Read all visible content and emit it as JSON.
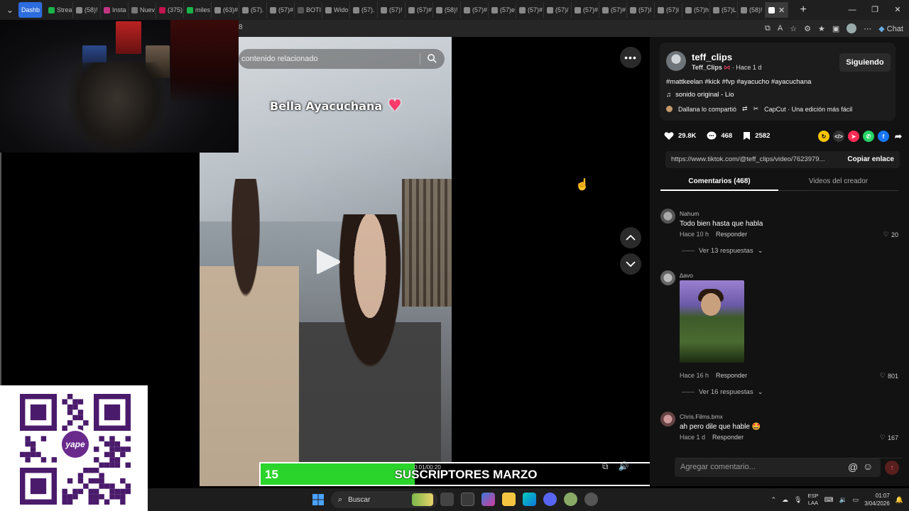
{
  "browser": {
    "tabs": [
      {
        "label": "Dashb",
        "color": "#2d6cdf"
      },
      {
        "label": "Strea",
        "color": "#1ab34a"
      },
      {
        "label": "(58)!",
        "color": "#888"
      },
      {
        "label": "Insta",
        "color": "#c13584"
      },
      {
        "label": "Nuev",
        "color": "#777"
      },
      {
        "label": "(375)",
        "color": "#c0144f"
      },
      {
        "label": "miles",
        "color": "#1ab34a"
      },
      {
        "label": "(63)#",
        "color": "#888"
      },
      {
        "label": "(57).",
        "color": "#888"
      },
      {
        "label": "(57)#",
        "color": "#888"
      },
      {
        "label": "BOTI",
        "color": "#555"
      },
      {
        "label": "Wido",
        "color": "#888"
      },
      {
        "label": "(57).",
        "color": "#888"
      },
      {
        "label": "(57)!",
        "color": "#888"
      },
      {
        "label": "(57)#",
        "color": "#888"
      },
      {
        "label": "(58)!",
        "color": "#888"
      },
      {
        "label": "(57)#",
        "color": "#888"
      },
      {
        "label": "(57)e",
        "color": "#888"
      },
      {
        "label": "(57)#",
        "color": "#888"
      },
      {
        "label": "(57)/",
        "color": "#888"
      },
      {
        "label": "(57)#",
        "color": "#888"
      },
      {
        "label": "(57)#",
        "color": "#888"
      },
      {
        "label": "(57)I",
        "color": "#888"
      },
      {
        "label": "(57)l",
        "color": "#888"
      },
      {
        "label": "(57)h",
        "color": "#888"
      },
      {
        "label": "(57)L",
        "color": "#888"
      },
      {
        "label": "(58)!",
        "color": "#888"
      }
    ],
    "url_fragment": "8",
    "chat_label": "Chat"
  },
  "video": {
    "search_placeholder": "contenido relacionado",
    "caption": "Bella Ayacuchana",
    "time": "0:01/00:20"
  },
  "subscriber_goal": {
    "current": "15",
    "title": "SUSCRIPTORES MARZO",
    "goal": "40",
    "progress": 0.375,
    "fill_color": "#2bd42b"
  },
  "author": {
    "username": "teff_clips",
    "display_name": "Teff_Clips",
    "time": "· Hace 1 d",
    "follow_label": "Siguiendo",
    "hashtags": "#mattkeelan #kick #fvp #ayacucho #ayacuchana",
    "sound": "sonido original - Lio",
    "shared_by": "Dallana lo compartió",
    "capcut": "CapCut · Una edición más fácil"
  },
  "stats": {
    "likes": "29.8K",
    "comments": "468",
    "saves": "2582"
  },
  "link": {
    "url": "https://www.tiktok.com/@teff_clips/video/7623979...",
    "copy_label": "Copiar enlace"
  },
  "tabs": {
    "comments": "Comentarios (468)",
    "videos": "Videos del creador"
  },
  "comments": [
    {
      "user": "Nahum",
      "text": "Todo bien hasta que habla",
      "time": "Hace 10 h",
      "reply": "Responder",
      "likes": "20",
      "replies": "Ver 13 respuestas"
    },
    {
      "user": "∆avo",
      "text": "",
      "time": "Hace 16 h",
      "reply": "Responder",
      "likes": "801",
      "replies": "Ver 16 respuestas"
    },
    {
      "user": "Chris.Films.bmx",
      "text": "ah pero dile que hable 🤩",
      "time": "Hace 1 d",
      "reply": "Responder",
      "likes": "167"
    }
  ],
  "comment_input": {
    "placeholder": "Agregar comentario..."
  },
  "taskbar": {
    "search_label": "Buscar",
    "lang_top": "ESP",
    "lang_bottom": "LAA",
    "time": "01:07",
    "date": "3/04/2026"
  }
}
